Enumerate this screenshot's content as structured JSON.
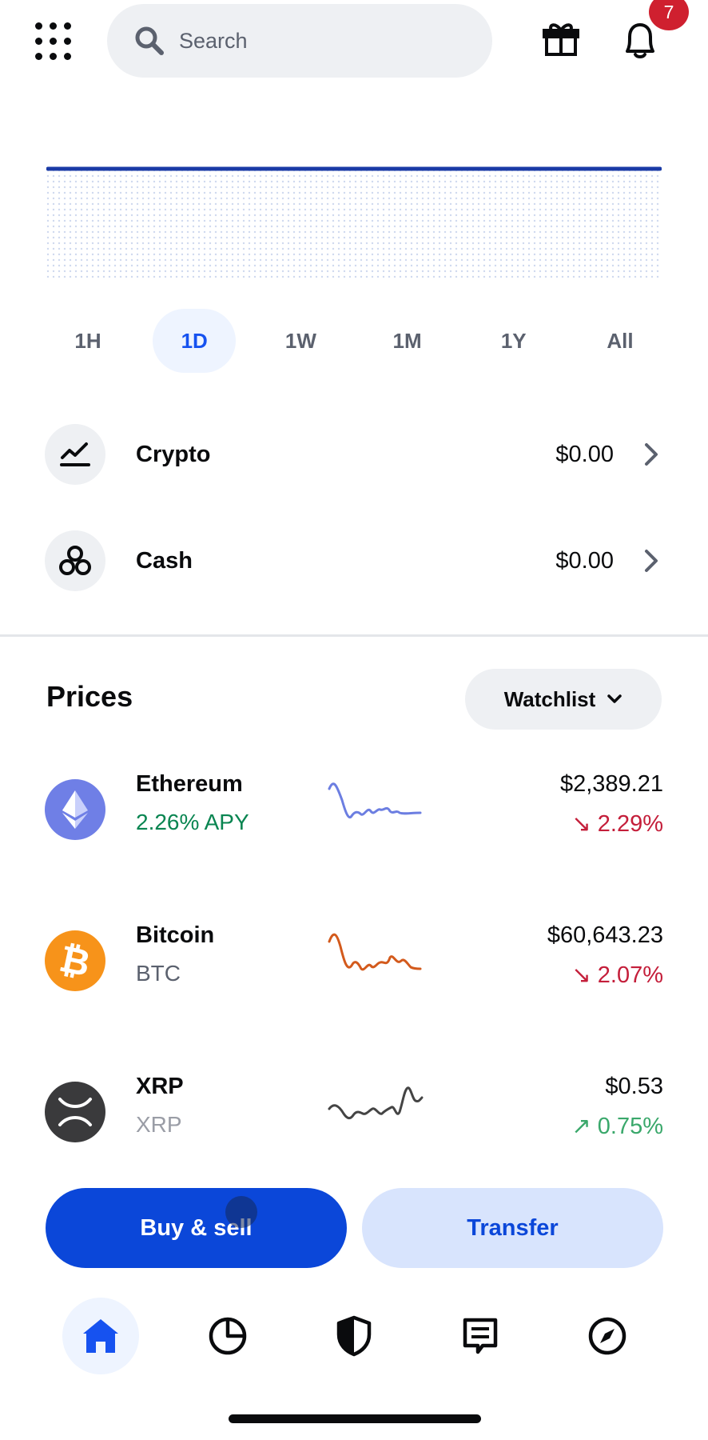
{
  "header": {
    "search_placeholder": "Search",
    "notification_count": "7"
  },
  "range_tabs": [
    "1H",
    "1D",
    "1W",
    "1M",
    "1Y",
    "All"
  ],
  "range_selected": "1D",
  "balances": [
    {
      "label": "Crypto",
      "value": "$0.00",
      "icon": "chart-line-icon"
    },
    {
      "label": "Cash",
      "value": "$0.00",
      "icon": "cash-coins-icon"
    }
  ],
  "prices": {
    "title": "Prices",
    "filter_label": "Watchlist",
    "assets": [
      {
        "name": "Ethereum",
        "sub": "2.26% APY",
        "price": "$2,389.21",
        "change": "↘ 2.29%",
        "direction": "down",
        "color": "#6c7ee1",
        "icon": "ethereum-icon"
      },
      {
        "name": "Bitcoin",
        "sub": "BTC",
        "price": "$60,643.23",
        "change": "↘ 2.07%",
        "direction": "down",
        "color": "#d35a1c",
        "icon": "bitcoin-icon"
      },
      {
        "name": "XRP",
        "sub": "XRP",
        "price": "$0.53",
        "change": "↗ 0.75%",
        "direction": "up",
        "color": "#444444",
        "icon": "xrp-icon"
      }
    ]
  },
  "actions": {
    "buy_sell": "Buy & sell",
    "transfer": "Transfer"
  },
  "nav": [
    {
      "icon": "home-icon",
      "active": true
    },
    {
      "icon": "portfolio-pie-icon",
      "active": false
    },
    {
      "icon": "shield-icon",
      "active": false
    },
    {
      "icon": "news-receipt-icon",
      "active": false
    },
    {
      "icon": "explore-compass-icon",
      "active": false
    }
  ],
  "colors": {
    "accent": "#0b47d9",
    "accent_light": "#d8e4fd",
    "negative": "#c41e3a",
    "positive": "#3aa86b",
    "positive_apy": "#098551"
  }
}
